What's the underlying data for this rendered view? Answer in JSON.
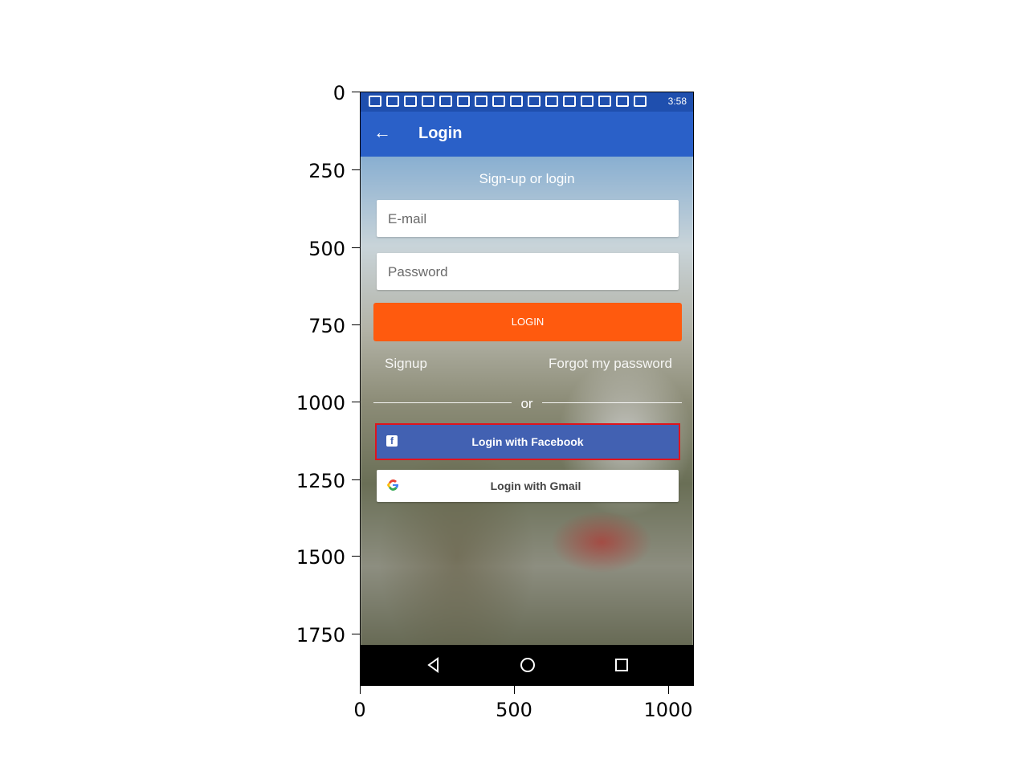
{
  "status_bar": {
    "time": "3:58"
  },
  "app_bar": {
    "title": "Login",
    "back_icon": "arrow-left-icon"
  },
  "form": {
    "subtitle": "Sign-up or login",
    "email_placeholder": "E-mail",
    "password_placeholder": "Password",
    "login_button": "LOGIN",
    "signup_link": "Signup",
    "forgot_link": "Forgot my password",
    "or_label": "or",
    "facebook_button": "Login with Facebook",
    "gmail_button": "Login with Gmail"
  },
  "colors": {
    "app_bar": "#2a60c8",
    "status_bar": "#1f4fae",
    "login_button": "#ff5a0e",
    "facebook_button": "#4261b2",
    "highlight_border": "#e0141c"
  },
  "axes": {
    "y_ticks": [
      "0",
      "250",
      "500",
      "750",
      "1000",
      "1250",
      "1500",
      "1750"
    ],
    "x_ticks": [
      "0",
      "500",
      "1000"
    ]
  },
  "nav_bar": {
    "icons": [
      "back-triangle-icon",
      "home-circle-icon",
      "recents-square-icon"
    ]
  }
}
